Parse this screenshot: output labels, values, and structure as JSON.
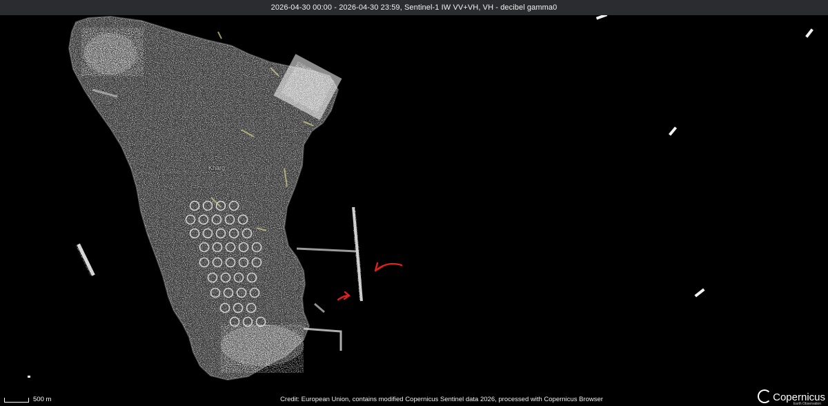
{
  "header": {
    "title": "2026-04-30 00:00 - 2026-04-30 23:59, Sentinel-1 IW VV+VH, VH - decibel gamma0"
  },
  "map": {
    "place_label": "Kharg",
    "annotation_color": "#e02020",
    "island_speckle_color": "#ffffff"
  },
  "scalebar": {
    "label": "500 m"
  },
  "credit": "Credit: European Union, contains modified Copernicus Sentinel data 2026, processed with Copernicus Browser",
  "logo": {
    "name": "Copernicus",
    "subtitle": "Earth Observation"
  }
}
